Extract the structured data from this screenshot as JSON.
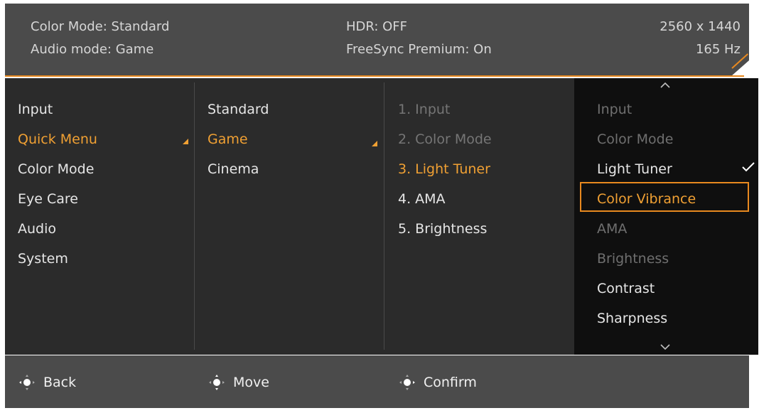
{
  "header": {
    "color_mode": "Color Mode: Standard",
    "audio_mode": "Audio mode: Game",
    "hdr": "HDR: OFF",
    "freesync": "FreeSync Premium: On",
    "resolution": "2560 x 1440",
    "refresh": "165 Hz"
  },
  "col1": [
    "Input",
    "Quick Menu",
    "Color Mode",
    "Eye Care",
    "Audio",
    "System"
  ],
  "col2": [
    "Standard",
    "Game",
    "Cinema"
  ],
  "col3": [
    "1. Input",
    "2. Color Mode",
    "3. Light Tuner",
    "4. AMA",
    "5. Brightness"
  ],
  "col4": [
    "Input",
    "Color Mode",
    "Light Tuner",
    "Color Vibrance",
    "AMA",
    "Brightness",
    "Contrast",
    "Sharpness"
  ],
  "footer": {
    "back": "Back",
    "move": "Move",
    "confirm": "Confirm"
  },
  "icons": {
    "check": "checkmark-icon",
    "up": "chevron-up-icon",
    "down": "chevron-down-icon",
    "nav": "five-way-joystick-icon"
  },
  "colors": {
    "accent": "#f0a033",
    "header_bg": "#4b4b4b",
    "menu_bg": "#2b2b2b",
    "col4_bg": "#0f0f0f"
  }
}
